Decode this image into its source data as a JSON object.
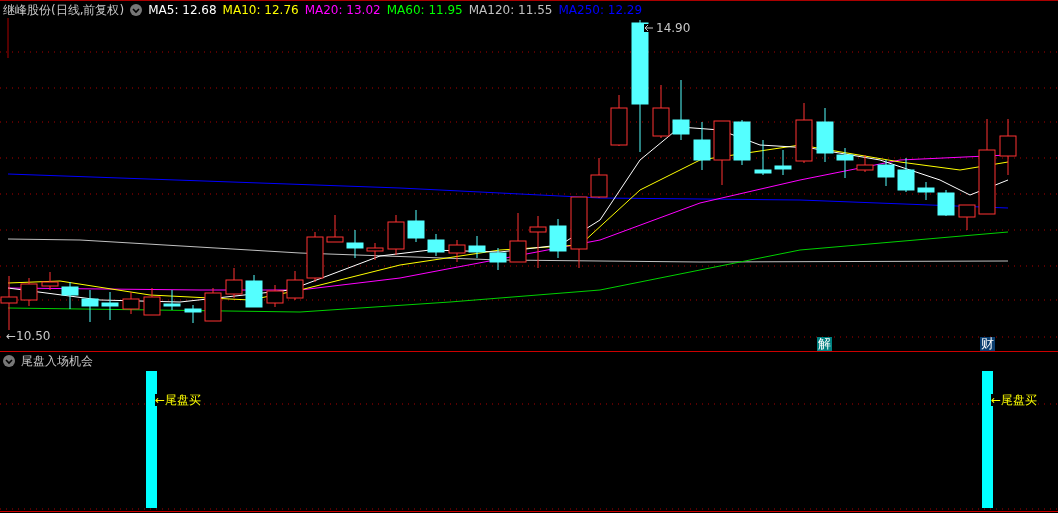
{
  "title": "继峰股份(日线,前复权)",
  "ma_legend": [
    {
      "label": "MA5: 12.68",
      "color": "#ffffff"
    },
    {
      "label": "MA10: 12.76",
      "color": "#ffff00"
    },
    {
      "label": "MA20: 13.02",
      "color": "#ff00ff"
    },
    {
      "label": "MA60: 11.95",
      "color": "#00ff00"
    },
    {
      "label": "MA120: 11.55",
      "color": "#c0c0c0"
    },
    {
      "label": "MA250: 12.29",
      "color": "#0000ff"
    }
  ],
  "price_labels": {
    "high": "14.90",
    "low": "←10.50"
  },
  "event_markers": [
    {
      "text": "解",
      "color": "#008080"
    },
    {
      "text": "财",
      "color": "#0a3d6e"
    }
  ],
  "indicator": {
    "title": "尾盘入场机会",
    "signals": [
      {
        "text": "←尾盘买"
      },
      {
        "text": "←尾盘买"
      }
    ]
  }
}
